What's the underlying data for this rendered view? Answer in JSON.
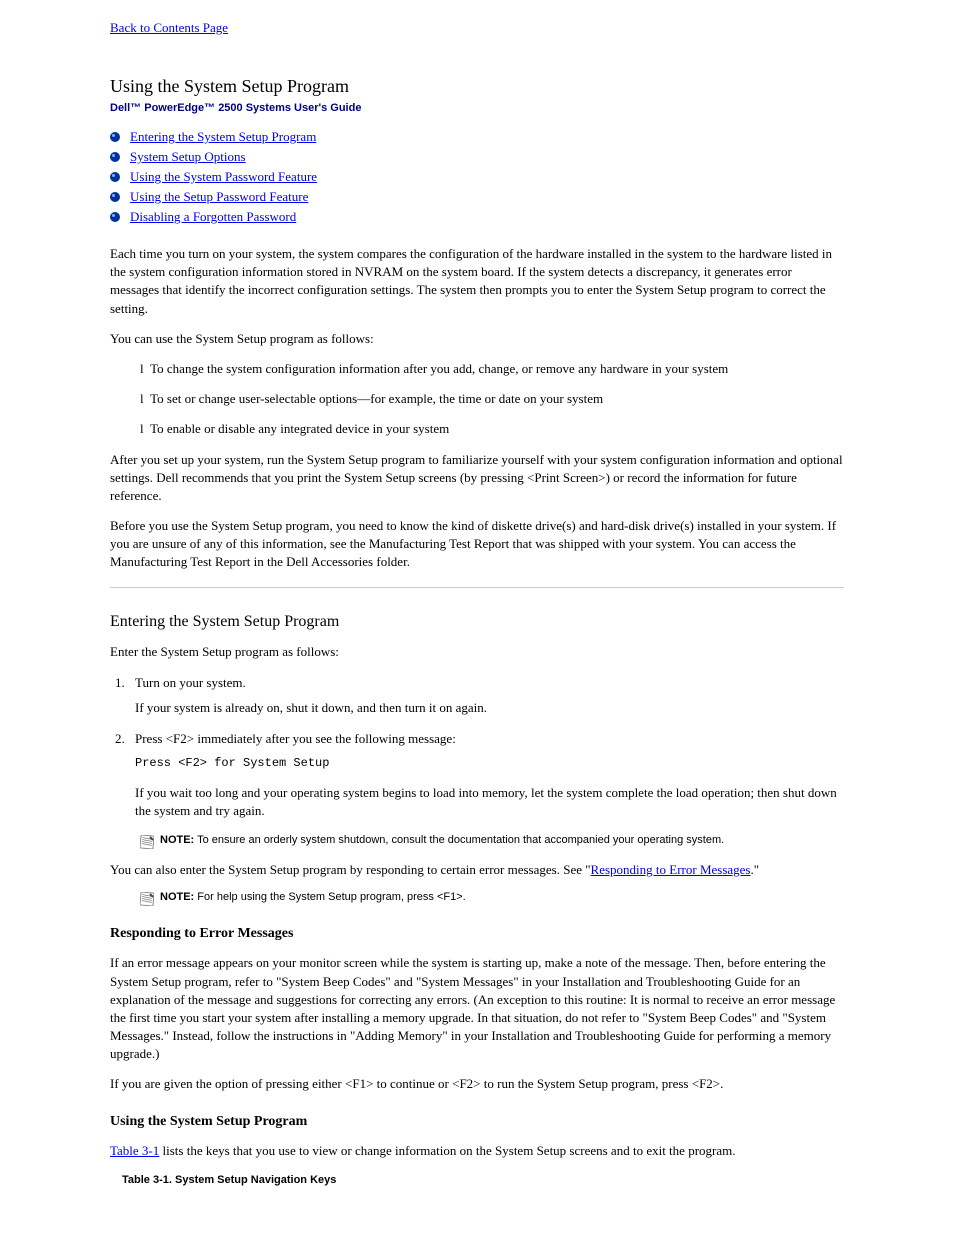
{
  "backLink": "Back to Contents Page",
  "chapterTitle": "Using the System Setup Program",
  "guideSubtitle": "Dell™ PowerEdge™ 2500 Systems User's Guide",
  "toc": [
    "Entering the System Setup Program",
    "System Setup Options",
    "Using the System Password Feature",
    "Using the Setup Password Feature",
    "Disabling a Forgotten Password"
  ],
  "intro1": "Each time you turn on your system, the system compares the configuration of the hardware installed in the system to the hardware listed in the system configuration information stored in NVRAM on the system board. If the system detects a discrepancy, it generates error messages that identify the incorrect configuration settings. The system then prompts you to enter the System Setup program to correct the setting.",
  "intro2": "You can use the System Setup program as follows:",
  "introItemsPrefix": "l",
  "introItems": [
    "To change the system configuration information after you add, change, or remove any hardware in your system",
    "To set or change user-selectable options—for example, the time or date on your system",
    "To enable or disable any integrated device in your system"
  ],
  "intro3": "After you set up your system, run the System Setup program to familiarize yourself with your system configuration information and optional settings. Dell recommends that you print the System Setup screens (by pressing <Print Screen>) or record the information for future reference.",
  "intro4": "Before you use the System Setup program, you need to know the kind of diskette drive(s) and hard-disk drive(s) installed in your system. If you are unsure of any of this information, see the Manufacturing Test Report that was shipped with your system. You can access the Manufacturing Test Report in the Dell Accessories folder.",
  "sectionEnter": {
    "title": "Entering the System Setup Program",
    "lead": "Enter the System Setup program as follows:",
    "step1": "Turn on your system.",
    "step1b": "If your system is already on, shut it down, and then turn it on again.",
    "step2a": "Press <F2> immediately after you see the following message:",
    "step2code": "Press <F2> for System Setup",
    "step2b": "If you wait too long and your operating system begins to load into memory, let the system complete the load operation; then shut down the system and try again.",
    "note1": "NOTE: To ensure an orderly system shutdown, consult the documentation that accompanied your operating system.",
    "afterSteps": "You can also enter the System Setup program by responding to certain error messages. See \"",
    "afterStepsLink": "Responding to Error Messages",
    "afterStepsEnd": ".\"",
    "note2": "NOTE: For help using the System Setup program, press <F1>."
  },
  "respondingHeading": "Responding to Error Messages",
  "respondingP1": "If an error message appears on your monitor screen while the system is starting up, make a note of the message. Then, before entering the System Setup program, refer to \"System Beep Codes\" and \"System Messages\" in your Installation and Troubleshooting Guide for an explanation of the message and suggestions for correcting any errors. (An exception to this routine: It is normal to receive an error message the first time you start your system after installing a memory upgrade. In that situation, do not refer to \"System Beep Codes\" and \"System Messages.\" Instead, follow the instructions in \"Adding Memory\" in your Installation and Troubleshooting Guide for performing a memory upgrade.)",
  "respondingP2": "If you are given the option of pressing either <F1> to continue or <F2> to run the System Setup program, press <F2>.",
  "usingHeading": "Using the System Setup Program",
  "usingP1a": "",
  "usingP1link": "Table 3-1",
  "usingP1b": " lists the keys that you use to view or change information on the System Setup screens and to exit the program.",
  "tableLabel": "Table 3-1. System Setup Navigation Keys"
}
